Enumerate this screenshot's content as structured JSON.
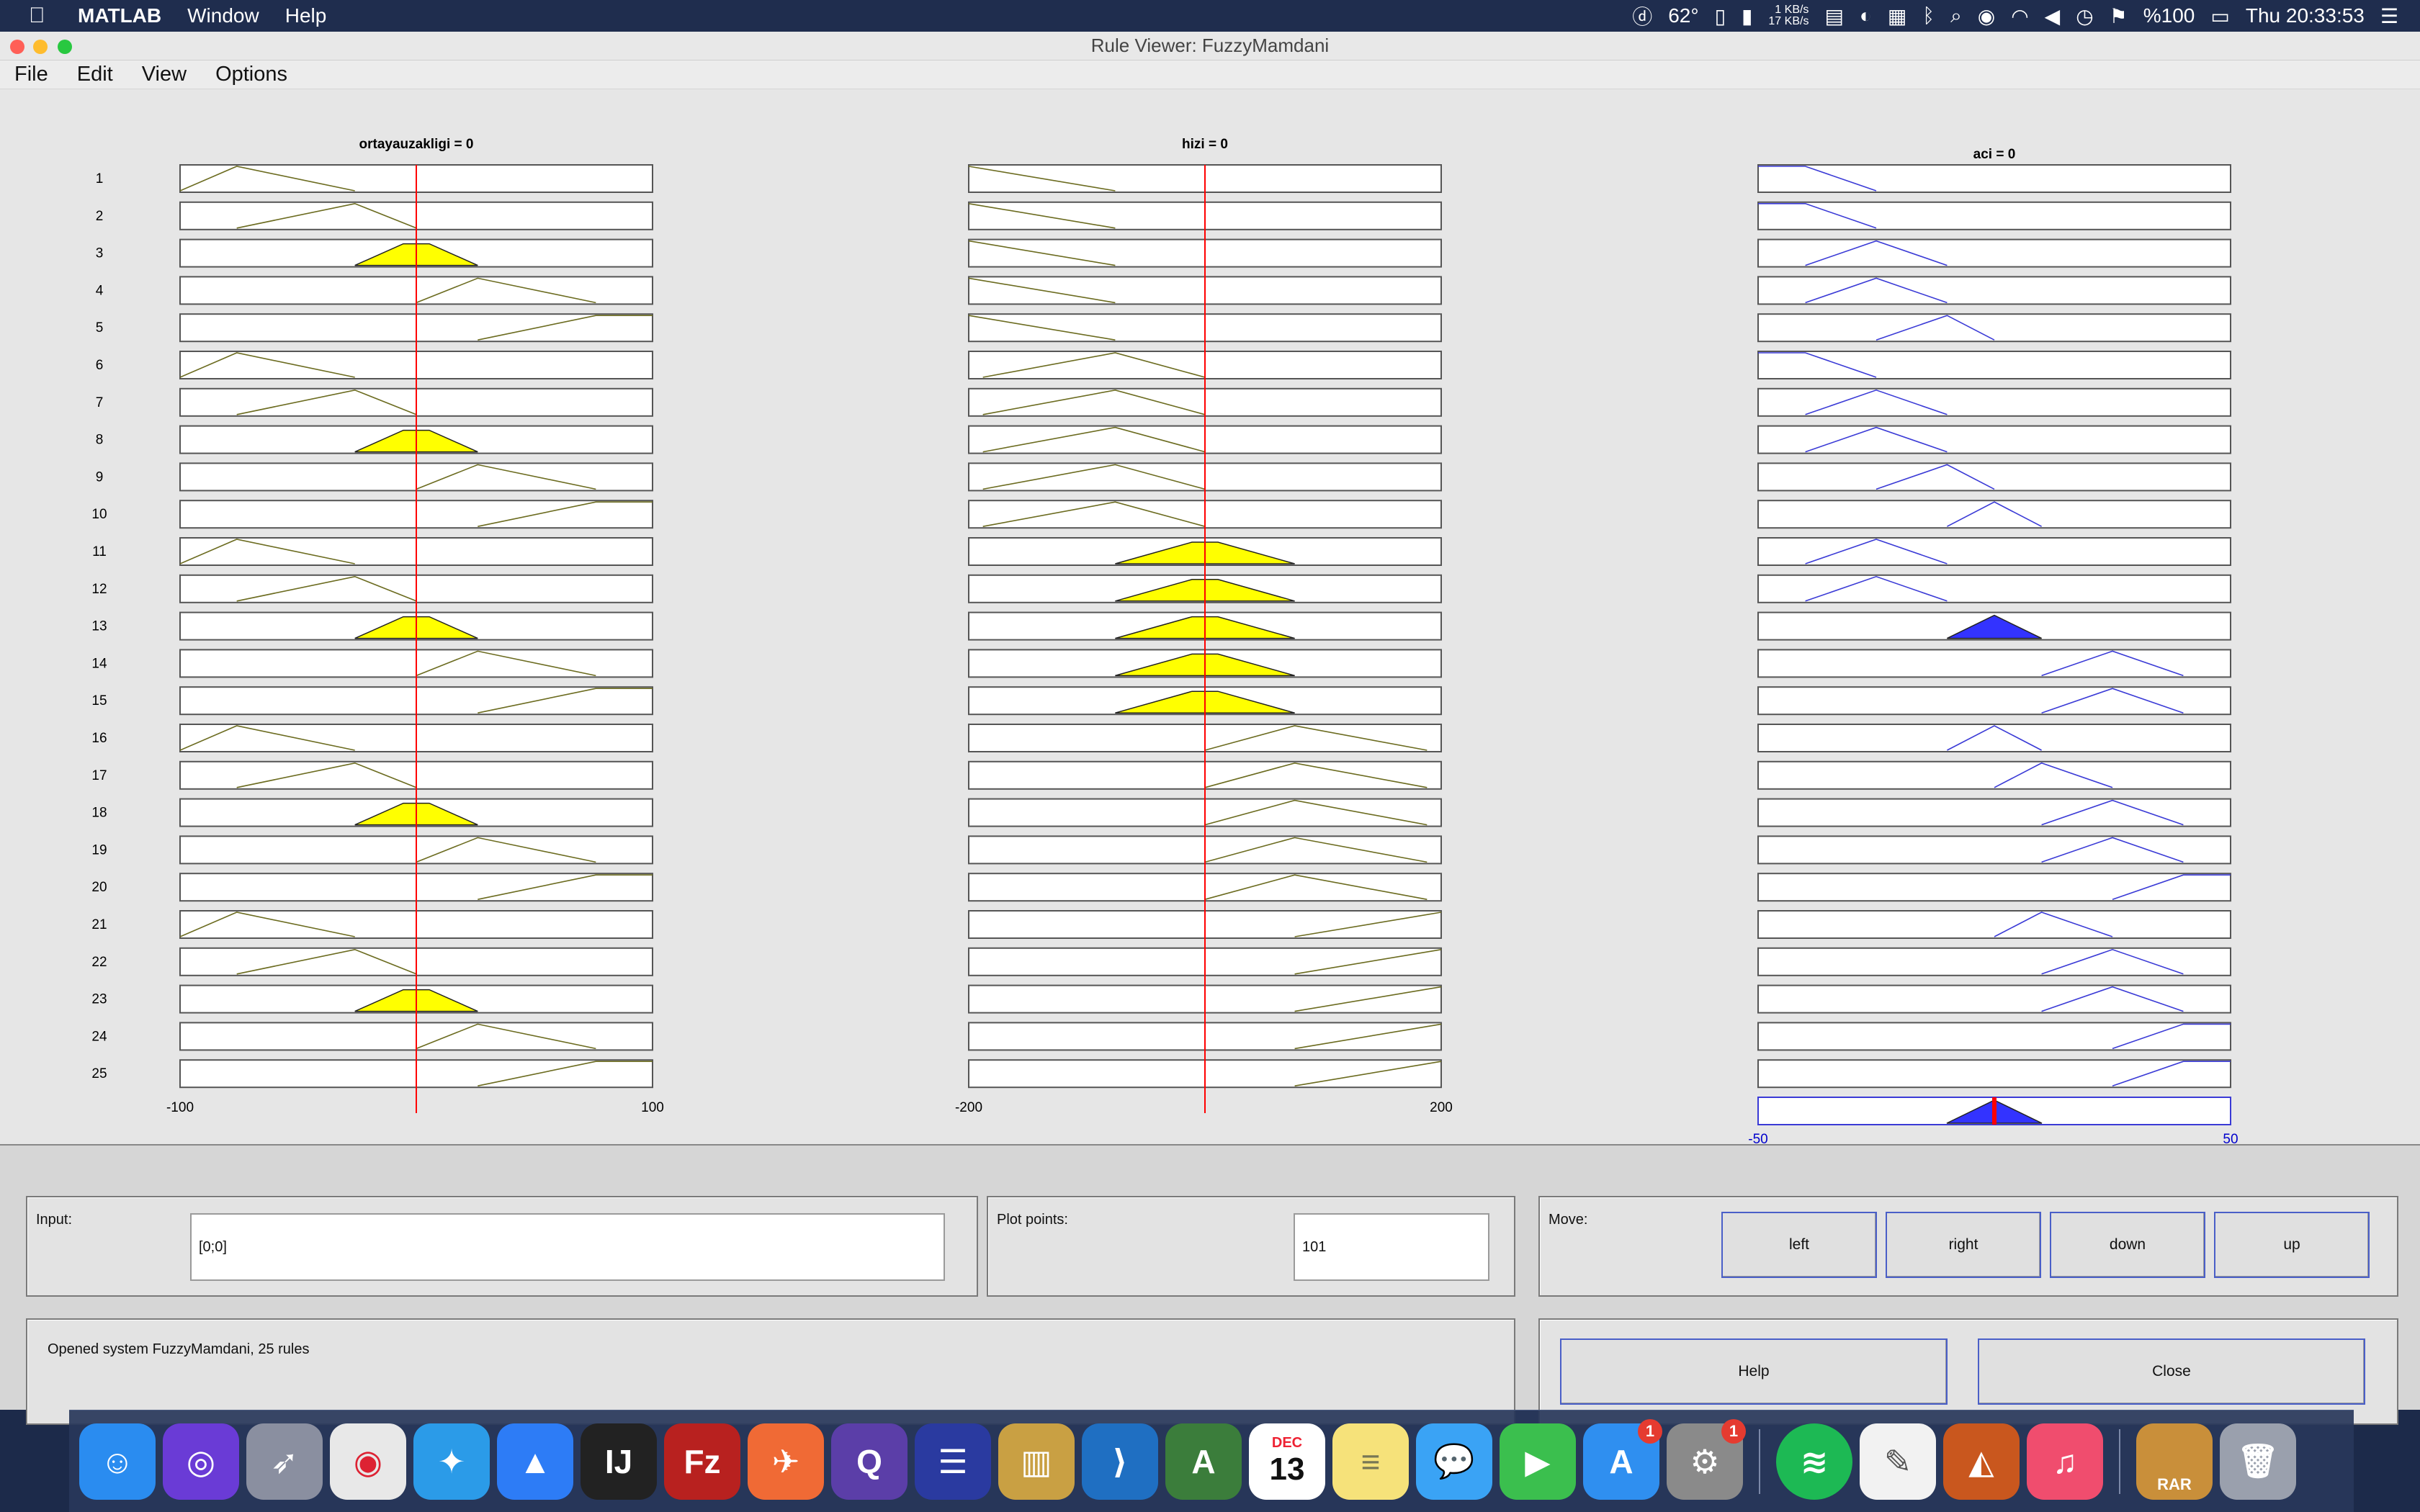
{
  "menubar": {
    "app": "MATLAB",
    "items": [
      "Window",
      "Help"
    ],
    "temperature": "62°",
    "net_up": "1 KB/s",
    "net_down": "17 KB/s",
    "battery": "%100",
    "clock": "Thu 20:33:53"
  },
  "window": {
    "title": "Rule Viewer: FuzzyMamdani",
    "menus": [
      "File",
      "Edit",
      "View",
      "Options"
    ]
  },
  "plots": {
    "col1_title": "ortayauzakligi = 0",
    "col2_title": "hizi = 0",
    "col3_title": "aci = 0",
    "col1_min": "-100",
    "col1_max": "100",
    "col2_min": "-200",
    "col2_max": "200",
    "col3_min": "-50",
    "col3_max": "50",
    "rule_count": 25,
    "input_color": "#6b6b1f",
    "input_fill": "#ffff00",
    "output_color": "#3a3ad6",
    "output_fill": "#3333ff",
    "cursor_color": "#ff0000",
    "col1_mf": [
      0,
      1,
      2,
      3,
      4,
      0,
      1,
      2,
      3,
      4,
      0,
      1,
      2,
      3,
      4,
      0,
      1,
      2,
      3,
      4,
      0,
      1,
      2,
      3,
      4
    ],
    "col2_mf": [
      0,
      0,
      0,
      0,
      0,
      1,
      1,
      1,
      1,
      1,
      2,
      2,
      2,
      2,
      2,
      3,
      3,
      3,
      3,
      3,
      4,
      4,
      4,
      4,
      4
    ],
    "col3_mf": [
      0,
      0,
      1,
      1,
      2,
      0,
      1,
      1,
      2,
      3,
      1,
      1,
      3,
      5,
      5,
      3,
      4,
      5,
      5,
      6,
      4,
      5,
      5,
      6,
      6
    ],
    "fired_rules": [
      3,
      8,
      11,
      12,
      13,
      14,
      15,
      18,
      23
    ],
    "output_rule": 13
  },
  "controls": {
    "input_label": "Input:",
    "input_value": "[0;0]",
    "plot_points_label": "Plot points:",
    "plot_points_value": "101",
    "move_label": "Move:",
    "move_left": "left",
    "move_right": "right",
    "move_down": "down",
    "move_up": "up",
    "status": "Opened system FuzzyMamdani, 25 rules",
    "help": "Help",
    "close": "Close"
  },
  "dock": {
    "calendar_month": "DEC",
    "calendar_day": "13",
    "appstore_badge": "1",
    "settings_badge": "1",
    "rar_label": "RAR"
  }
}
